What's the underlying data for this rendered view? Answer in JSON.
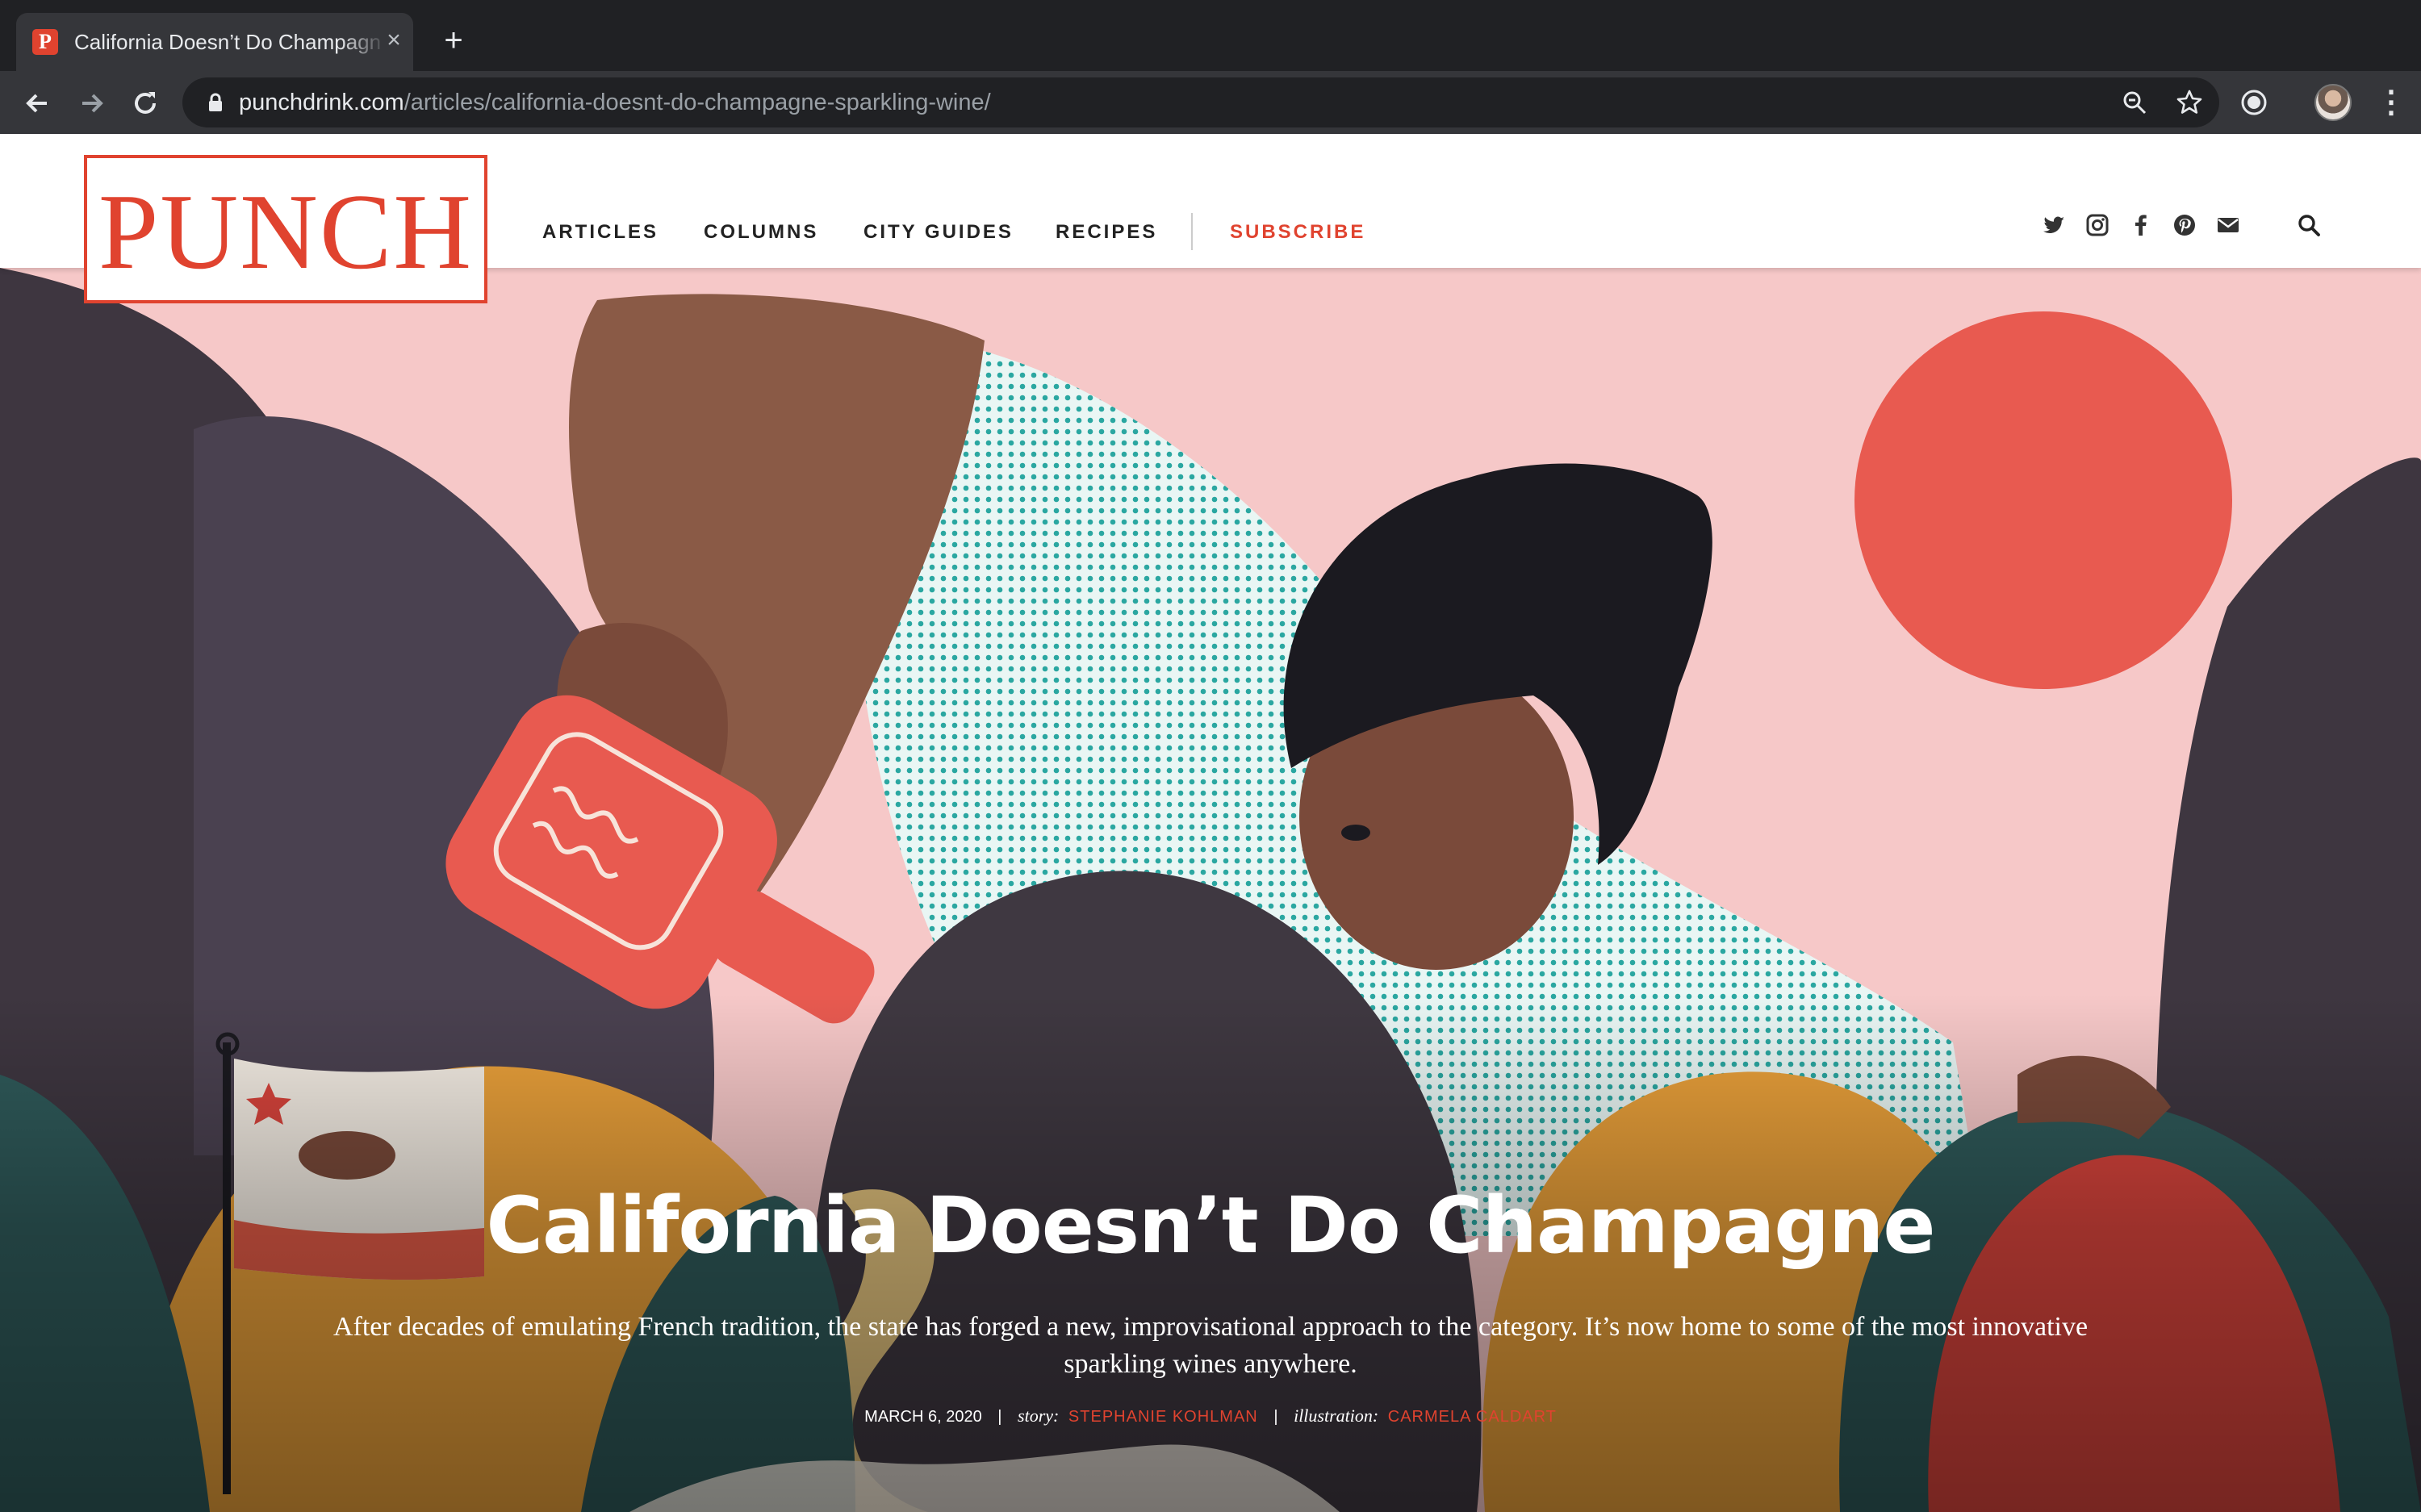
{
  "browser": {
    "tab_title": "California Doesn’t Do Champagne",
    "favicon_letter": "P",
    "new_tab": "+",
    "close": "×",
    "url_host": "punchdrink.com",
    "url_path": "/articles/california-doesnt-do-champagne-sparkling-wine/"
  },
  "site": {
    "logo": "PUNCH",
    "nav": [
      "ARTICLES",
      "COLUMNS",
      "CITY GUIDES",
      "RECIPES"
    ],
    "subscribe": "SUBSCRIBE",
    "social_icons": [
      "twitter-icon",
      "instagram-icon",
      "facebook-icon",
      "pinterest-icon",
      "email-icon",
      "search-icon"
    ],
    "accent_color": "#e0432f"
  },
  "article": {
    "title": "California Doesn’t Do Champagne",
    "dek": "After decades of emulating French tradition, the state has forged a new, improvisational approach to the category. It’s now home to some of the most innovative sparkling wines anywhere.",
    "date": "MARCH 6, 2020",
    "separator": "|",
    "story_label": "story:",
    "story_author": "STEPHANIE KOHLMAN",
    "illustration_label": "illustration:",
    "illustrator": "CARMELA CALDART"
  }
}
